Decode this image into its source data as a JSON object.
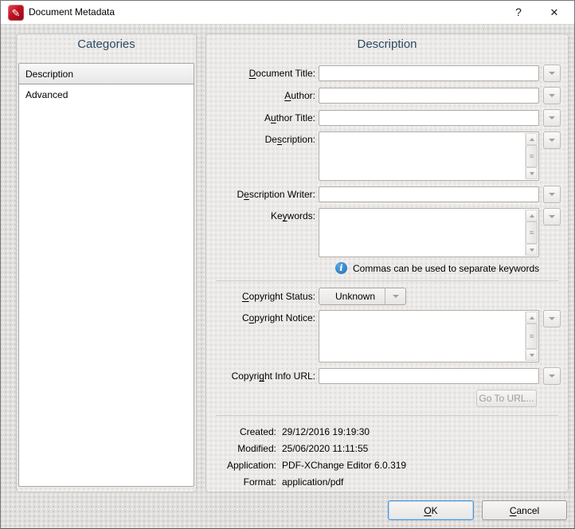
{
  "window": {
    "title": "Document Metadata",
    "help_label": "?",
    "close_label": "✕"
  },
  "categories": {
    "header": "Categories",
    "items": [
      {
        "label": "Description",
        "selected": true
      },
      {
        "label": "Advanced",
        "selected": false
      }
    ]
  },
  "description_panel": {
    "header": "Description",
    "document_title": {
      "label": "Document Title:",
      "value": ""
    },
    "author": {
      "label": "Author:",
      "value": ""
    },
    "author_title": {
      "label": "Author Title:",
      "value": ""
    },
    "description": {
      "label": "Description:",
      "value": ""
    },
    "description_writer": {
      "label": "Description Writer:",
      "value": ""
    },
    "keywords": {
      "label": "Keywords:",
      "value": ""
    },
    "keywords_note": "Commas can be used to separate keywords",
    "copyright_status": {
      "label": "Copyright Status:",
      "value": "Unknown"
    },
    "copyright_notice": {
      "label": "Copyright Notice:",
      "value": ""
    },
    "copyright_info_url": {
      "label": "Copyright Info URL:",
      "value": ""
    },
    "go_to_url_label": "Go To URL...",
    "info": [
      {
        "label": "Created:",
        "value": "29/12/2016 19:19:30"
      },
      {
        "label": "Modified:",
        "value": "25/06/2020 11:11:55"
      },
      {
        "label": "Application:",
        "value": "PDF-XChange Editor 6.0.319"
      },
      {
        "label": "Format:",
        "value": "application/pdf"
      }
    ]
  },
  "footer": {
    "ok_label": "OK",
    "cancel_label": "Cancel"
  },
  "colors": {
    "header_text": "#2b4a63",
    "info_icon": "#2d7fc4",
    "ok_focus_border": "#4f94d6",
    "app_icon_red": "#c01120"
  }
}
